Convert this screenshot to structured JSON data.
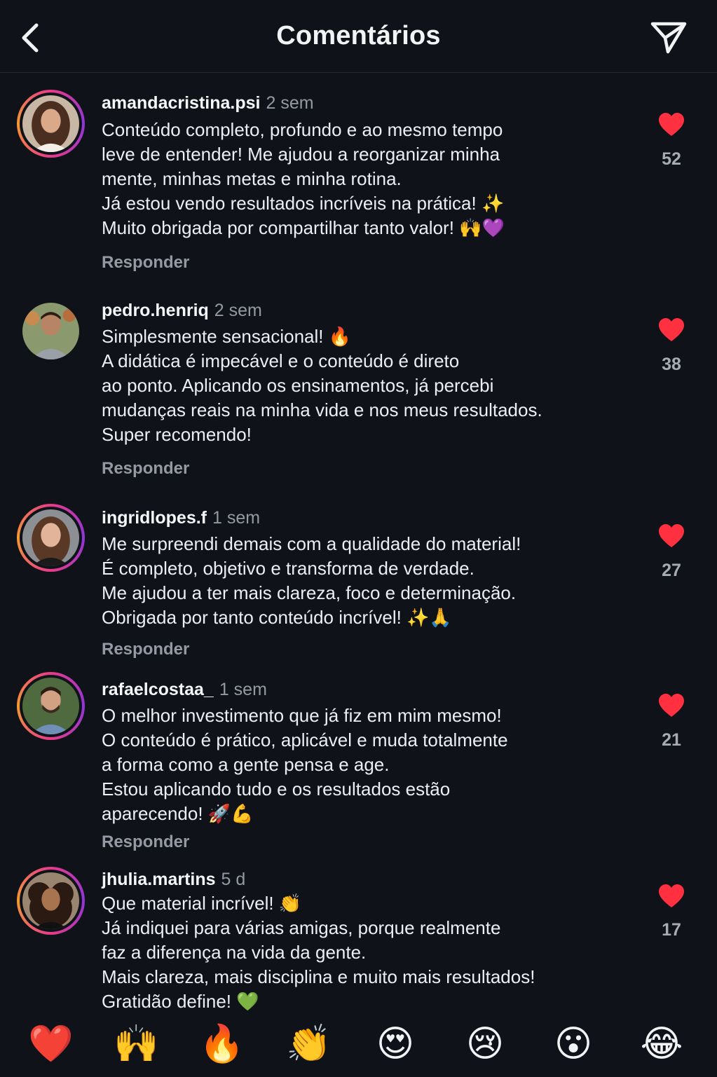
{
  "header": {
    "title": "Comentários"
  },
  "comments": [
    {
      "username": "amandacristina.psi",
      "time": "2 sem",
      "lines": [
        "Conteúdo completo, profundo e ao mesmo tempo",
        "leve de entender! Me ajudou a reorganizar minha",
        "mente, minhas metas e minha rotina.",
        "Já estou vendo resultados incríveis na prática! ✨",
        "Muito obrigada por compartilhar tanto valor! 🙌💜"
      ],
      "reply_label": "Responder",
      "likes": "52"
    },
    {
      "username": "pedro.henriq",
      "time": "2 sem",
      "lines": [
        "Simplesmente sensacional! 🔥",
        "A didática é impecável e o conteúdo é direto",
        "ao ponto. Aplicando os ensinamentos, já percebi",
        "mudanças reais na minha vida e nos meus resultados.",
        "Super recomendo!"
      ],
      "reply_label": "Responder",
      "likes": "38"
    },
    {
      "username": "ingridlopes.f",
      "time": "1 sem",
      "lines": [
        "Me surpreendi demais com a qualidade do material!",
        "É completo, objetivo e transforma de verdade.",
        "Me ajudou a ter mais clareza, foco e determinação.",
        "Obrigada por tanto conteúdo incrível! ✨🙏"
      ],
      "reply_label": "Responder",
      "likes": "27"
    },
    {
      "username": "rafaelcostaa_",
      "time": "1 sem",
      "lines": [
        "O melhor investimento que já fiz em mim mesmo!",
        "O conteúdo é prático, aplicável e muda totalmente",
        "a forma como a gente pensa e age.",
        "Estou aplicando tudo e os resultados estão",
        "aparecendo! 🚀💪"
      ],
      "reply_label": "Responder",
      "likes": "21"
    },
    {
      "username": "jhulia.martins",
      "time": "5 d",
      "lines": [
        "Que material incrível! 👏",
        "Já indiquei para várias amigas, porque realmente",
        "faz a diferença na vida da gente.",
        "Mais clareza, mais disciplina e muito mais resultados!",
        "Gratidão define! 💚"
      ],
      "reply_label": "",
      "likes": "17"
    }
  ],
  "reactions": [
    "❤️",
    "🙌",
    "🔥",
    "👏",
    "😍",
    "😢",
    "😮",
    "😂"
  ],
  "colors": {
    "background": "#0f1219",
    "like_heart": "#ff3040",
    "muted_text": "#9499a3"
  }
}
